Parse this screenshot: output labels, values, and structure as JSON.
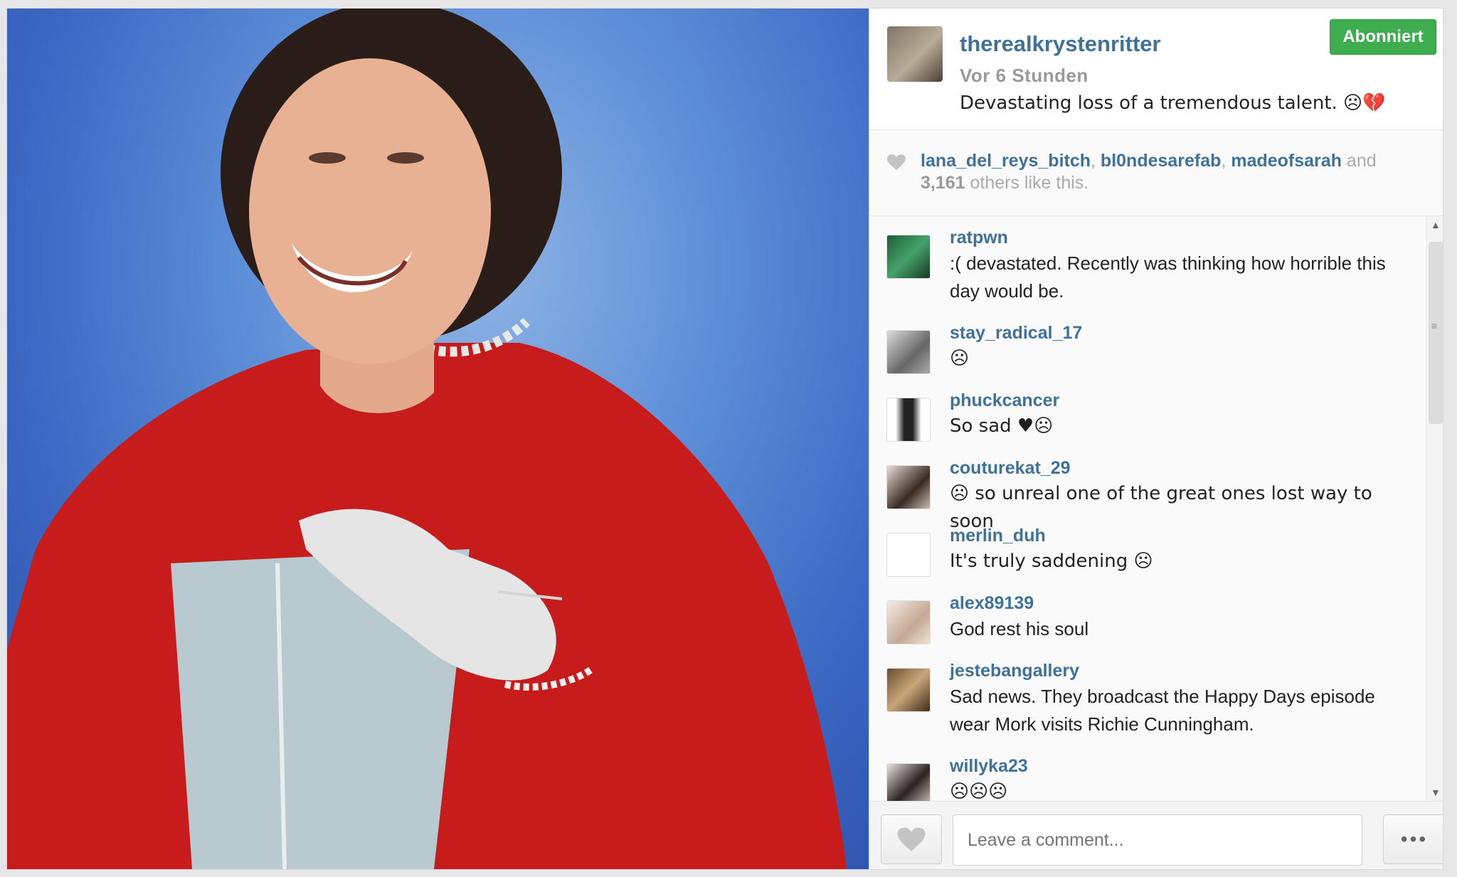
{
  "post": {
    "owner": {
      "username": "therealkrystenritter",
      "time": "Vor 6 Stunden",
      "caption": "Devastating loss of a tremendous talent. ☹💔"
    },
    "follow_label": "Abonniert",
    "likes": {
      "users": [
        "lana_del_reys_bitch",
        "bl0ndesarefab",
        "madeofsarah"
      ],
      "sep1": ", ",
      "sep2": ", ",
      "and": " and",
      "count": "3,161",
      "suffix": " others like this."
    }
  },
  "comments": [
    {
      "user": "ratpwn",
      "text": ":( devastated. Recently was thinking how horrible this day would be."
    },
    {
      "user": "stay_radical_17",
      "text": "☹"
    },
    {
      "user": "phuckcancer",
      "text": "So sad ♥☹"
    },
    {
      "user": "couturekat_29",
      "text": "☹ so unreal one of the great ones lost way to soon"
    },
    {
      "user": "merlin_duh",
      "text": "It's truly saddening ☹"
    },
    {
      "user": "alex89139",
      "text": "God rest his soul"
    },
    {
      "user": "jestebangallery",
      "text": "Sad news. They broadcast the Happy Days episode wear Mork visits Richie Cunningham."
    },
    {
      "user": "willyka23",
      "text": "☹☹☹"
    }
  ],
  "footer": {
    "comment_placeholder": "Leave a comment...",
    "more_label": "•••"
  },
  "colors": {
    "link": "#3f729b",
    "follow_green": "#3dad4f"
  }
}
